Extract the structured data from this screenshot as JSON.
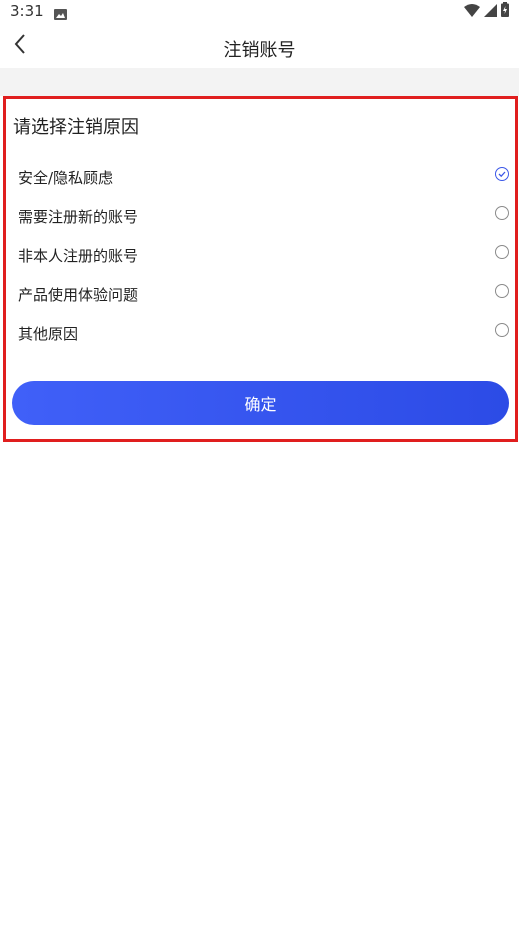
{
  "status_bar": {
    "time": "3:31",
    "icons": [
      "gallery-icon",
      "wifi-icon",
      "signal-icon",
      "battery-charging-icon"
    ]
  },
  "header": {
    "title": "注销账号",
    "back_icon": "chevron-left-icon"
  },
  "panel": {
    "heading": "请选择注销原因",
    "reasons": [
      {
        "label": "安全/隐私顾虑",
        "selected": true
      },
      {
        "label": "需要注册新的账号",
        "selected": false
      },
      {
        "label": "非本人注册的账号",
        "selected": false
      },
      {
        "label": "产品使用体验问题",
        "selected": false
      },
      {
        "label": "其他原因",
        "selected": false
      }
    ],
    "confirm_label": "确定"
  },
  "colors": {
    "accent": "#3b57e8",
    "highlight_border": "#e01e1e",
    "band": "#f3f3f3"
  }
}
